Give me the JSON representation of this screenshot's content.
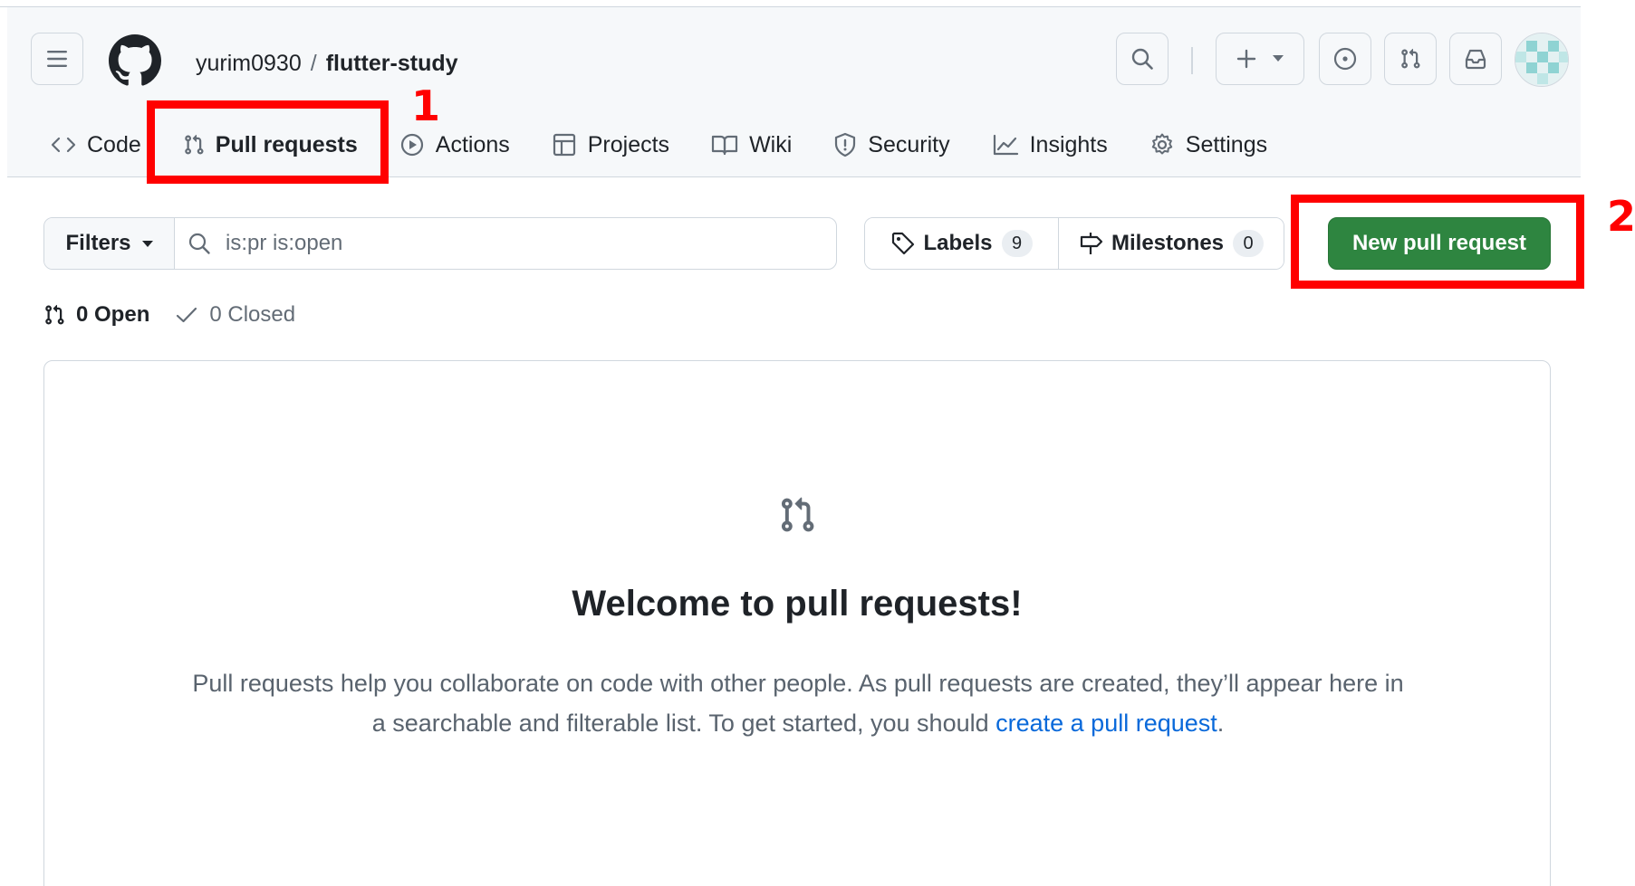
{
  "repo": {
    "owner": "yurim0930",
    "separator": "/",
    "name": "flutter-study"
  },
  "tabs": [
    {
      "label": "Code",
      "icon": "code-icon"
    },
    {
      "label": "Pull requests",
      "icon": "git-pull-request-icon"
    },
    {
      "label": "Actions",
      "icon": "play-icon"
    },
    {
      "label": "Projects",
      "icon": "table-icon"
    },
    {
      "label": "Wiki",
      "icon": "book-icon"
    },
    {
      "label": "Security",
      "icon": "shield-icon"
    },
    {
      "label": "Insights",
      "icon": "graph-icon"
    },
    {
      "label": "Settings",
      "icon": "gear-icon"
    }
  ],
  "toolbar": {
    "filters_label": "Filters",
    "search_value": "is:pr is:open",
    "labels_label": "Labels",
    "labels_count": "9",
    "milestones_label": "Milestones",
    "milestones_count": "0",
    "new_pr_label": "New pull request"
  },
  "states": {
    "open_label": "0 Open",
    "closed_label": "0 Closed"
  },
  "blankslate": {
    "title": "Welcome to pull requests!",
    "text_before": "Pull requests help you collaborate on code with other people. As pull requests are created, they’ll appear here in a searchable and filterable list. To get started, you should ",
    "link_text": "create a pull request",
    "text_after": "."
  },
  "annotations": {
    "first": "1",
    "second": "2"
  },
  "colors": {
    "primary_button": "#2e8540",
    "link": "#0969da",
    "annotation": "#ff0000"
  }
}
